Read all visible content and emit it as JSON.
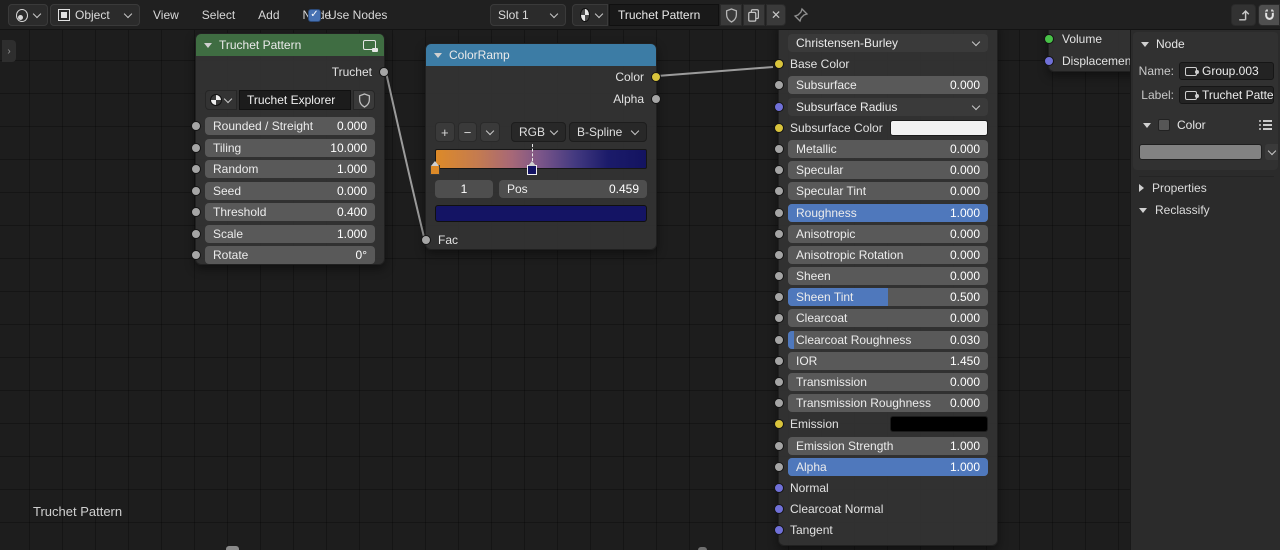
{
  "header": {
    "mode_selector": "Object",
    "menus": [
      "View",
      "Select",
      "Add",
      "Node"
    ],
    "use_nodes_label": "Use Nodes",
    "slot_selector": "Slot 1",
    "material_name": "Truchet Pattern"
  },
  "colors": {
    "accent_blue": "#4f78bc",
    "truchet_header_green": "#3f6d42",
    "colorramp_header_blue": "#3c7ca5",
    "socket_yellow": "#d9c43c",
    "socket_gray": "#a5a5a5",
    "socket_green": "#48c248",
    "socket_purple": "#7070d8"
  },
  "truchet_node": {
    "title": "Truchet Pattern",
    "output_label": "Truchet",
    "group_name": "Truchet Explorer",
    "inputs": [
      {
        "label": "Rounded / Streight",
        "value": "0.000"
      },
      {
        "label": "Tiling",
        "value": "10.000"
      },
      {
        "label": "Random",
        "value": "1.000"
      },
      {
        "label": "Seed",
        "value": "0.000"
      },
      {
        "label": "Threshold",
        "value": "0.400"
      },
      {
        "label": "Scale",
        "value": "1.000"
      },
      {
        "label": "Rotate",
        "value": "0°"
      }
    ]
  },
  "colorramp_node": {
    "title": "ColorRamp",
    "outputs": [
      {
        "label": "Color",
        "socket": "yellow"
      },
      {
        "label": "Alpha",
        "socket": "gray"
      }
    ],
    "add_button": "+",
    "remove_button": "−",
    "color_mode": "RGB",
    "interpolation": "B-Spline",
    "active_index": "1",
    "pos_label": "Pos",
    "pos_value": "0.459",
    "fac_label": "Fac",
    "gradient_stops": [
      {
        "pos_pct": 0,
        "color": "#dd8a28",
        "selected": false
      },
      {
        "pos_pct": 45.9,
        "color": "#141464",
        "selected": true
      }
    ],
    "gradient_css_stops": [
      "#dd8a28 0%",
      "#c47b50 20%",
      "#a76877 36%",
      "#7a5589 50%",
      "#443a80 66%",
      "#1b1b6a 82%",
      "#131360 100%"
    ]
  },
  "principled_node": {
    "rows": [
      {
        "label": "Christensen-Burley",
        "type": "dropdown",
        "socket": null
      },
      {
        "label": "Base Color",
        "type": "label",
        "socket": "yellow"
      },
      {
        "label": "Subsurface",
        "type": "slider",
        "value": "0.000",
        "fill": 0,
        "socket": "gray"
      },
      {
        "label": "Subsurface Radius",
        "type": "dropdown",
        "socket": "purple"
      },
      {
        "label": "Subsurface Color",
        "type": "color",
        "swatch": "#f2f2f2",
        "socket": "yellow"
      },
      {
        "label": "Metallic",
        "type": "slider",
        "value": "0.000",
        "fill": 0,
        "socket": "gray"
      },
      {
        "label": "Specular",
        "type": "slider",
        "value": "0.000",
        "fill": 0,
        "socket": "gray"
      },
      {
        "label": "Specular Tint",
        "type": "slider",
        "value": "0.000",
        "fill": 0,
        "socket": "gray"
      },
      {
        "label": "Roughness",
        "type": "slider",
        "value": "1.000",
        "fill": 1,
        "socket": "gray"
      },
      {
        "label": "Anisotropic",
        "type": "slider",
        "value": "0.000",
        "fill": 0,
        "socket": "gray"
      },
      {
        "label": "Anisotropic Rotation",
        "type": "slider",
        "value": "0.000",
        "fill": 0,
        "socket": "gray"
      },
      {
        "label": "Sheen",
        "type": "slider",
        "value": "0.000",
        "fill": 0,
        "socket": "gray"
      },
      {
        "label": "Sheen Tint",
        "type": "slider",
        "value": "0.500",
        "fill": 0.5,
        "socket": "gray"
      },
      {
        "label": "Clearcoat",
        "type": "slider",
        "value": "0.000",
        "fill": 0,
        "socket": "gray"
      },
      {
        "label": "Clearcoat Roughness",
        "type": "slider",
        "value": "0.030",
        "fill": 0.03,
        "socket": "gray"
      },
      {
        "label": "IOR",
        "type": "value",
        "value": "1.450",
        "socket": "gray"
      },
      {
        "label": "Transmission",
        "type": "slider",
        "value": "0.000",
        "fill": 0,
        "socket": "gray"
      },
      {
        "label": "Transmission Roughness",
        "type": "slider",
        "value": "0.000",
        "fill": 0,
        "socket": "gray"
      },
      {
        "label": "Emission",
        "type": "color",
        "swatch": "#000000",
        "socket": "yellow"
      },
      {
        "label": "Emission Strength",
        "type": "slider",
        "value": "1.000",
        "fill": 0,
        "socket": "gray"
      },
      {
        "label": "Alpha",
        "type": "slider",
        "value": "1.000",
        "fill": 1,
        "socket": "gray"
      },
      {
        "label": "Normal",
        "type": "label",
        "socket": "purple"
      },
      {
        "label": "Clearcoat Normal",
        "type": "label",
        "socket": "purple"
      },
      {
        "label": "Tangent",
        "type": "label",
        "socket": "purple"
      }
    ]
  },
  "output_node": {
    "rows": [
      {
        "label": "Volume",
        "socket": "green"
      },
      {
        "label": "Displacement",
        "socket": "purple"
      }
    ]
  },
  "sidebar": {
    "panel_title": "Node",
    "name_label": "Name:",
    "name_value": "Group.003",
    "label_label": "Label:",
    "label_value": "Truchet Pattern",
    "color_section_label": "Color",
    "properties_label": "Properties",
    "reclassify_label": "Reclassify"
  },
  "canvas": {
    "frame_label": "Truchet Pattern"
  }
}
